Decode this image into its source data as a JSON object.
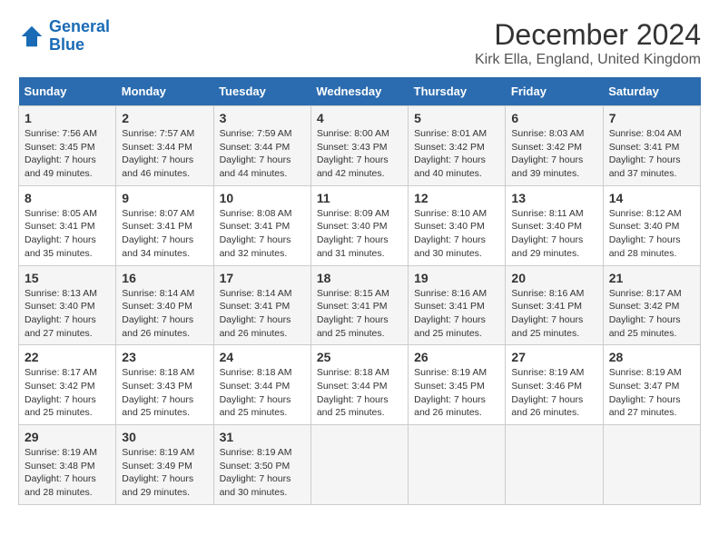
{
  "logo": {
    "line1": "General",
    "line2": "Blue"
  },
  "title": "December 2024",
  "location": "Kirk Ella, England, United Kingdom",
  "days_of_week": [
    "Sunday",
    "Monday",
    "Tuesday",
    "Wednesday",
    "Thursday",
    "Friday",
    "Saturday"
  ],
  "weeks": [
    [
      {
        "num": "1",
        "sunrise": "7:56 AM",
        "sunset": "3:45 PM",
        "daylight": "7 hours and 49 minutes."
      },
      {
        "num": "2",
        "sunrise": "7:57 AM",
        "sunset": "3:44 PM",
        "daylight": "7 hours and 46 minutes."
      },
      {
        "num": "3",
        "sunrise": "7:59 AM",
        "sunset": "3:44 PM",
        "daylight": "7 hours and 44 minutes."
      },
      {
        "num": "4",
        "sunrise": "8:00 AM",
        "sunset": "3:43 PM",
        "daylight": "7 hours and 42 minutes."
      },
      {
        "num": "5",
        "sunrise": "8:01 AM",
        "sunset": "3:42 PM",
        "daylight": "7 hours and 40 minutes."
      },
      {
        "num": "6",
        "sunrise": "8:03 AM",
        "sunset": "3:42 PM",
        "daylight": "7 hours and 39 minutes."
      },
      {
        "num": "7",
        "sunrise": "8:04 AM",
        "sunset": "3:41 PM",
        "daylight": "7 hours and 37 minutes."
      }
    ],
    [
      {
        "num": "8",
        "sunrise": "8:05 AM",
        "sunset": "3:41 PM",
        "daylight": "7 hours and 35 minutes."
      },
      {
        "num": "9",
        "sunrise": "8:07 AM",
        "sunset": "3:41 PM",
        "daylight": "7 hours and 34 minutes."
      },
      {
        "num": "10",
        "sunrise": "8:08 AM",
        "sunset": "3:41 PM",
        "daylight": "7 hours and 32 minutes."
      },
      {
        "num": "11",
        "sunrise": "8:09 AM",
        "sunset": "3:40 PM",
        "daylight": "7 hours and 31 minutes."
      },
      {
        "num": "12",
        "sunrise": "8:10 AM",
        "sunset": "3:40 PM",
        "daylight": "7 hours and 30 minutes."
      },
      {
        "num": "13",
        "sunrise": "8:11 AM",
        "sunset": "3:40 PM",
        "daylight": "7 hours and 29 minutes."
      },
      {
        "num": "14",
        "sunrise": "8:12 AM",
        "sunset": "3:40 PM",
        "daylight": "7 hours and 28 minutes."
      }
    ],
    [
      {
        "num": "15",
        "sunrise": "8:13 AM",
        "sunset": "3:40 PM",
        "daylight": "7 hours and 27 minutes."
      },
      {
        "num": "16",
        "sunrise": "8:14 AM",
        "sunset": "3:40 PM",
        "daylight": "7 hours and 26 minutes."
      },
      {
        "num": "17",
        "sunrise": "8:14 AM",
        "sunset": "3:41 PM",
        "daylight": "7 hours and 26 minutes."
      },
      {
        "num": "18",
        "sunrise": "8:15 AM",
        "sunset": "3:41 PM",
        "daylight": "7 hours and 25 minutes."
      },
      {
        "num": "19",
        "sunrise": "8:16 AM",
        "sunset": "3:41 PM",
        "daylight": "7 hours and 25 minutes."
      },
      {
        "num": "20",
        "sunrise": "8:16 AM",
        "sunset": "3:41 PM",
        "daylight": "7 hours and 25 minutes."
      },
      {
        "num": "21",
        "sunrise": "8:17 AM",
        "sunset": "3:42 PM",
        "daylight": "7 hours and 25 minutes."
      }
    ],
    [
      {
        "num": "22",
        "sunrise": "8:17 AM",
        "sunset": "3:42 PM",
        "daylight": "7 hours and 25 minutes."
      },
      {
        "num": "23",
        "sunrise": "8:18 AM",
        "sunset": "3:43 PM",
        "daylight": "7 hours and 25 minutes."
      },
      {
        "num": "24",
        "sunrise": "8:18 AM",
        "sunset": "3:44 PM",
        "daylight": "7 hours and 25 minutes."
      },
      {
        "num": "25",
        "sunrise": "8:18 AM",
        "sunset": "3:44 PM",
        "daylight": "7 hours and 25 minutes."
      },
      {
        "num": "26",
        "sunrise": "8:19 AM",
        "sunset": "3:45 PM",
        "daylight": "7 hours and 26 minutes."
      },
      {
        "num": "27",
        "sunrise": "8:19 AM",
        "sunset": "3:46 PM",
        "daylight": "7 hours and 26 minutes."
      },
      {
        "num": "28",
        "sunrise": "8:19 AM",
        "sunset": "3:47 PM",
        "daylight": "7 hours and 27 minutes."
      }
    ],
    [
      {
        "num": "29",
        "sunrise": "8:19 AM",
        "sunset": "3:48 PM",
        "daylight": "7 hours and 28 minutes."
      },
      {
        "num": "30",
        "sunrise": "8:19 AM",
        "sunset": "3:49 PM",
        "daylight": "7 hours and 29 minutes."
      },
      {
        "num": "31",
        "sunrise": "8:19 AM",
        "sunset": "3:50 PM",
        "daylight": "7 hours and 30 minutes."
      },
      null,
      null,
      null,
      null
    ]
  ]
}
